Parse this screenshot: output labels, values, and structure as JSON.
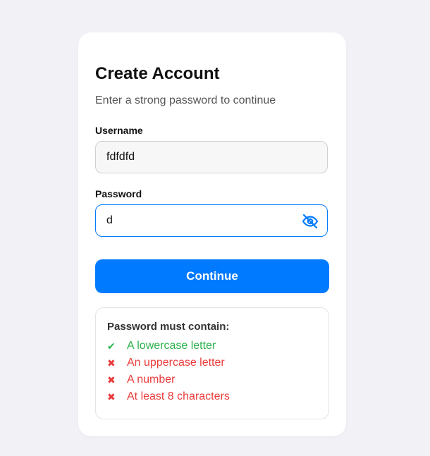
{
  "form": {
    "title": "Create Account",
    "subtitle": "Enter a strong password to continue",
    "username_label": "Username",
    "username_value": "fdfdfd",
    "password_label": "Password",
    "password_value": "d",
    "password_toggle_icon": "eye-slash-icon",
    "continue_label": "Continue"
  },
  "rules": {
    "title": "Password must contain:",
    "items": [
      {
        "text": "A lowercase letter",
        "met": true,
        "mark": "✔"
      },
      {
        "text": "An uppercase letter",
        "met": false,
        "mark": "✖"
      },
      {
        "text": "A number",
        "met": false,
        "mark": "✖"
      },
      {
        "text": "At least 8 characters",
        "met": false,
        "mark": "✖"
      }
    ]
  },
  "colors": {
    "accent": "#007aff",
    "success": "#2bb24c",
    "error": "#ea3b3b",
    "background": "#f1f1f6"
  }
}
